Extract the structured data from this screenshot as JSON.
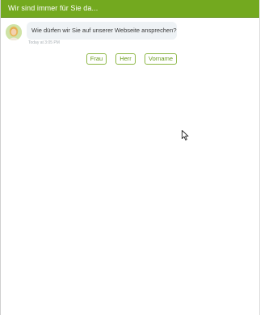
{
  "header": {
    "title": "Wir sind immer für Sie da...",
    "background_color": "#73a91f"
  },
  "message": {
    "avatar_icon": "agent-avatar-icon",
    "text": "Wie dürfen wir Sie auf unserer Webseite ansprechen?",
    "timestamp": "Today at 3:05 PM"
  },
  "choices": [
    {
      "label": "Frau"
    },
    {
      "label": "Herr"
    },
    {
      "label": "Vorname"
    }
  ],
  "accent_color": "#8db745",
  "cursor_icon": "mouse-pointer-icon"
}
